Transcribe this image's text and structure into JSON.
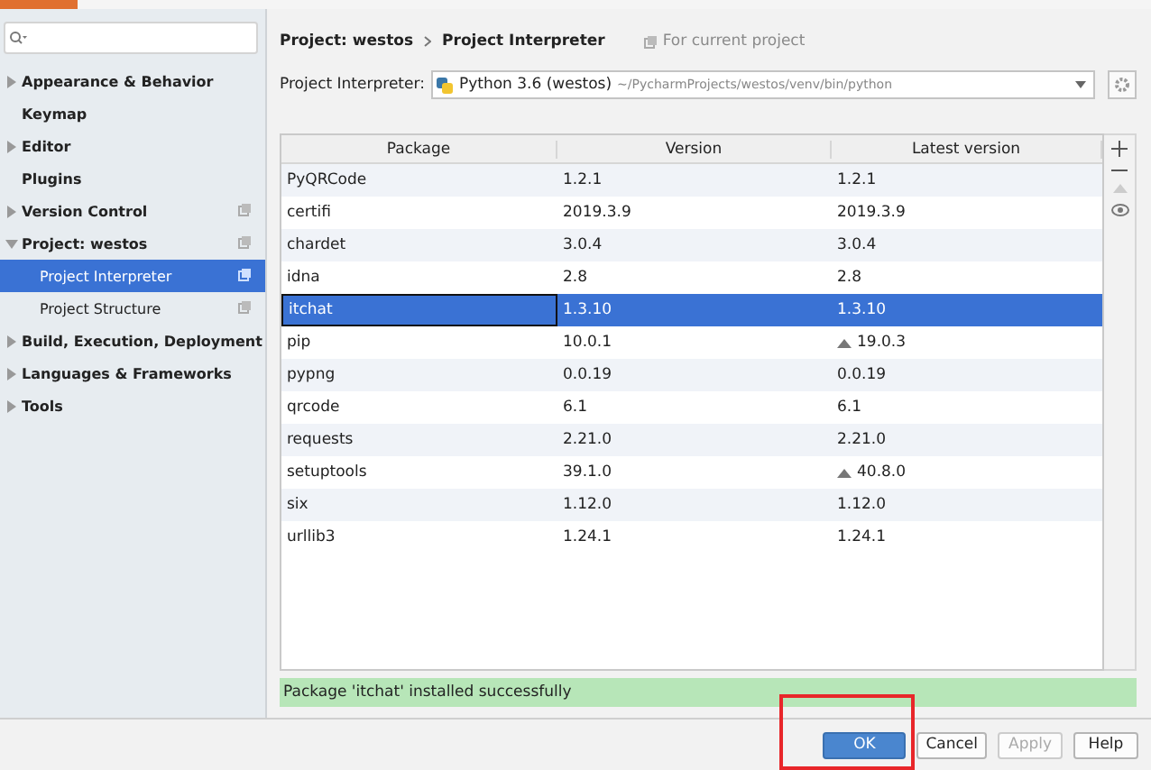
{
  "sidebar": {
    "items": [
      {
        "label": "Appearance & Behavior",
        "expanded": false,
        "selected": false,
        "per_project": false
      },
      {
        "label": "Keymap",
        "selected": false,
        "per_project": false
      },
      {
        "label": "Editor",
        "expanded": false,
        "selected": false,
        "per_project": false
      },
      {
        "label": "Plugins",
        "selected": false,
        "per_project": false
      },
      {
        "label": "Version Control",
        "expanded": false,
        "selected": false,
        "per_project": true
      },
      {
        "label": "Project: westos",
        "expanded": true,
        "selected": false,
        "per_project": true,
        "children": [
          {
            "label": "Project Interpreter",
            "selected": true,
            "per_project": true
          },
          {
            "label": "Project Structure",
            "selected": false,
            "per_project": true
          }
        ]
      },
      {
        "label": "Build, Execution, Deployment",
        "expanded": false,
        "selected": false,
        "per_project": false
      },
      {
        "label": "Languages & Frameworks",
        "expanded": false,
        "selected": false,
        "per_project": false
      },
      {
        "label": "Tools",
        "expanded": false,
        "selected": false,
        "per_project": false
      }
    ]
  },
  "breadcrumb": [
    "Project: westos",
    "Project Interpreter"
  ],
  "scope_note": "For current project",
  "interpreter": {
    "label": "Project Interpreter:",
    "name": "Python 3.6 (westos)",
    "path": "~/PycharmProjects/westos/venv/bin/python"
  },
  "table": {
    "columns": [
      "Package",
      "Version",
      "Latest version"
    ],
    "rows": [
      {
        "package": "PyQRCode",
        "version": "1.2.1",
        "latest": "1.2.1",
        "upgrade": false,
        "selected": false
      },
      {
        "package": "certifi",
        "version": "2019.3.9",
        "latest": "2019.3.9",
        "upgrade": false,
        "selected": false
      },
      {
        "package": "chardet",
        "version": "3.0.4",
        "latest": "3.0.4",
        "upgrade": false,
        "selected": false
      },
      {
        "package": "idna",
        "version": "2.8",
        "latest": "2.8",
        "upgrade": false,
        "selected": false
      },
      {
        "package": "itchat",
        "version": "1.3.10",
        "latest": "1.3.10",
        "upgrade": false,
        "selected": true
      },
      {
        "package": "pip",
        "version": "10.0.1",
        "latest": "19.0.3",
        "upgrade": true,
        "selected": false
      },
      {
        "package": "pypng",
        "version": "0.0.19",
        "latest": "0.0.19",
        "upgrade": false,
        "selected": false
      },
      {
        "package": "qrcode",
        "version": "6.1",
        "latest": "6.1",
        "upgrade": false,
        "selected": false
      },
      {
        "package": "requests",
        "version": "2.21.0",
        "latest": "2.21.0",
        "upgrade": false,
        "selected": false
      },
      {
        "package": "setuptools",
        "version": "39.1.0",
        "latest": "40.8.0",
        "upgrade": true,
        "selected": false
      },
      {
        "package": "six",
        "version": "1.12.0",
        "latest": "1.12.0",
        "upgrade": false,
        "selected": false
      },
      {
        "package": "urllib3",
        "version": "1.24.1",
        "latest": "1.24.1",
        "upgrade": false,
        "selected": false
      }
    ]
  },
  "status": "Package 'itchat' installed successfully",
  "buttons": [
    {
      "label": "OK",
      "primary": true,
      "disabled": false,
      "highlighted": true
    },
    {
      "label": "Cancel",
      "primary": false,
      "disabled": false,
      "highlighted": false
    },
    {
      "label": "Apply",
      "primary": false,
      "disabled": true,
      "highlighted": false
    },
    {
      "label": "Help",
      "primary": false,
      "disabled": false,
      "highlighted": false
    }
  ]
}
